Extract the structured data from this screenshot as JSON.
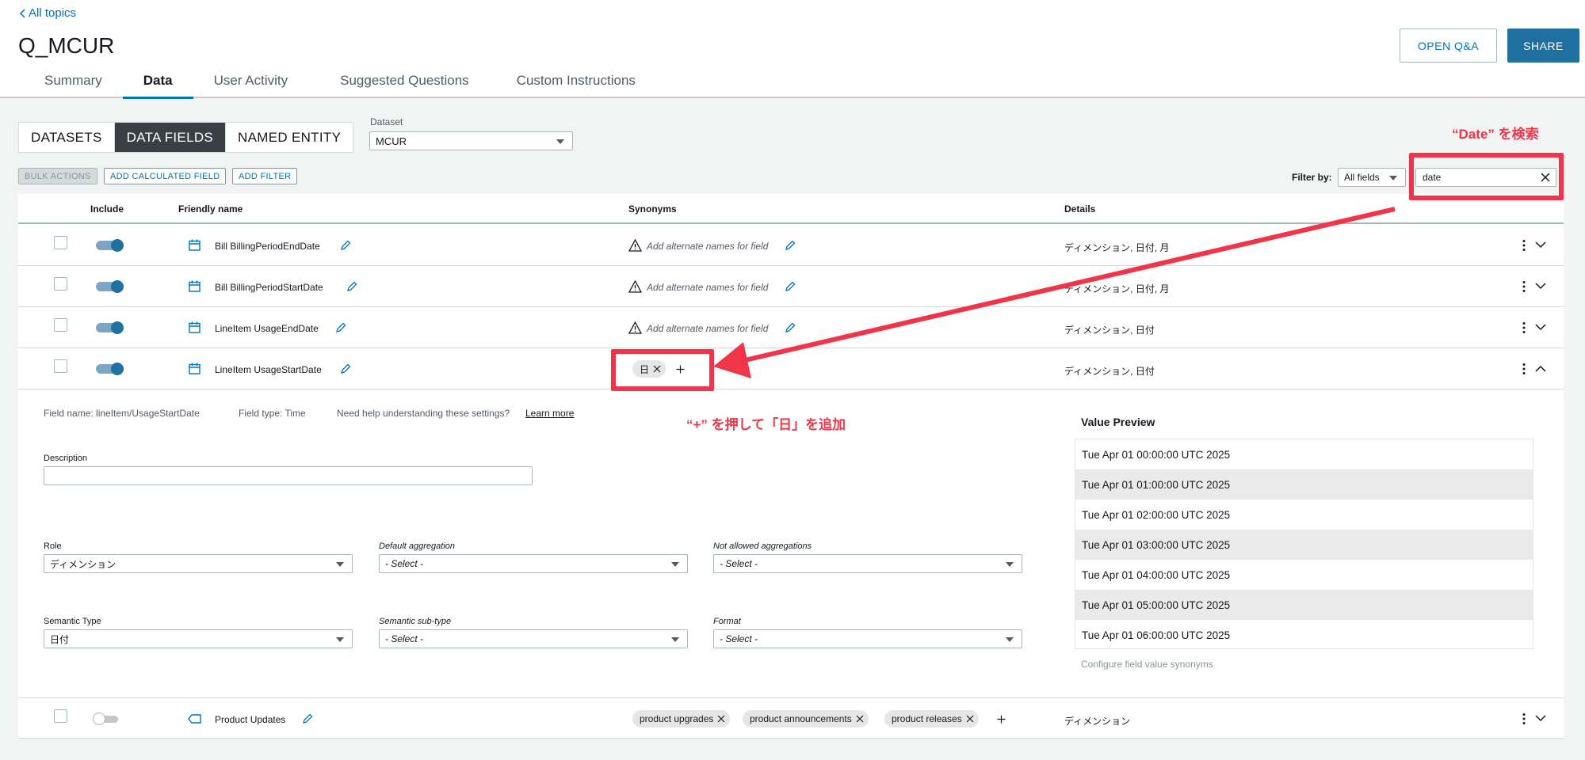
{
  "header": {
    "back_link": "All topics",
    "title": "Q_MCUR",
    "tabs": [
      "Summary",
      "Data",
      "User Activity",
      "Suggested Questions",
      "Custom Instructions"
    ],
    "open_qa_label": "OPEN Q&A",
    "share_label": "SHARE"
  },
  "toolbar": {
    "segments": [
      "DATASETS",
      "DATA FIELDS",
      "NAMED ENTITY"
    ],
    "dataset_label": "Dataset",
    "dataset_value": "MCUR",
    "bulk_actions": "BULK ACTIONS",
    "add_calculated_field": "ADD CALCULATED FIELD",
    "add_filter": "ADD FILTER",
    "filter_by_label": "Filter by:",
    "filter_value": "All fields",
    "search_value": "date"
  },
  "table": {
    "headers": {
      "include": "Include",
      "friendly_name": "Friendly name",
      "synonyms": "Synonyms",
      "details": "Details"
    },
    "rows": [
      {
        "name": "Bill BillingPeriodEndDate",
        "synonym_placeholder": "Add alternate names for field",
        "details": "ディメンション, 日付, 月"
      },
      {
        "name": "Bill BillingPeriodStartDate",
        "synonym_placeholder": "Add alternate names for field",
        "details": "ディメンション, 日付, 月"
      },
      {
        "name": "LineItem UsageEndDate",
        "synonym_placeholder": "Add alternate names for field",
        "details": "ディメンション, 日付"
      },
      {
        "name": "LineItem UsageStartDate",
        "synonyms": [
          "日"
        ],
        "details": "ディメンション, 日付"
      },
      {
        "name": "Product Updates",
        "synonyms": [
          "product upgrades",
          "product announcements",
          "product releases"
        ],
        "details": "ディメンション"
      }
    ]
  },
  "panel": {
    "field_name": "Field name: lineItem/UsageStartDate",
    "field_type": "Field type: Time",
    "help_text": "Need help understanding these settings?",
    "learn_more": "Learn more",
    "description_label": "Description",
    "description_value": "",
    "role_label": "Role",
    "role_value": "ディメンション",
    "default_agg_label": "Default aggregation",
    "default_agg_value": "- Select -",
    "not_allowed_agg_label": "Not allowed aggregations",
    "not_allowed_agg_value": "- Select -",
    "semantic_type_label": "Semantic Type",
    "semantic_type_value": "日付",
    "semantic_subtype_label": "Semantic sub-type",
    "semantic_subtype_value": "- Select -",
    "format_label": "Format",
    "format_value": "- Select -",
    "preview_title": "Value Preview",
    "preview_values": [
      "Tue Apr 01 00:00:00 UTC 2025",
      "Tue Apr 01 01:00:00 UTC 2025",
      "Tue Apr 01 02:00:00 UTC 2025",
      "Tue Apr 01 03:00:00 UTC 2025",
      "Tue Apr 01 04:00:00 UTC 2025",
      "Tue Apr 01 05:00:00 UTC 2025",
      "Tue Apr 01 06:00:00 UTC 2025"
    ],
    "configure_link": "Configure field value synonyms"
  },
  "annotations": {
    "search_note": "“Date” を検索",
    "add_note": "“+” を押して「日」を追加",
    "color": "#f0354a"
  },
  "colors": {
    "accent": "#0073bb",
    "primary_button": "#1f6fa0",
    "active_segment": "#3a3f45"
  }
}
